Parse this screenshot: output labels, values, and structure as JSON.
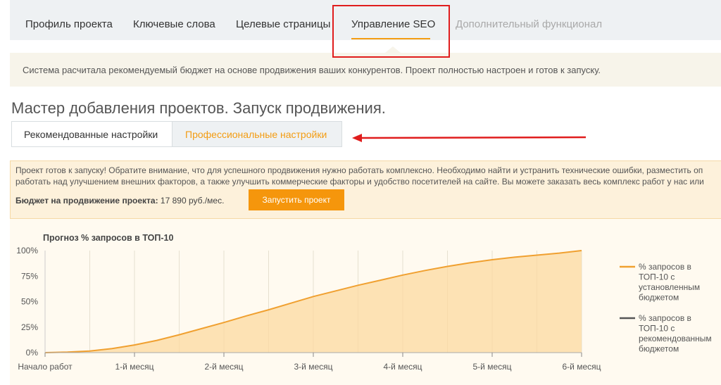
{
  "nav": {
    "tabs": [
      {
        "label": "Профиль проекта"
      },
      {
        "label": "Ключевые слова"
      },
      {
        "label": "Целевые страницы"
      },
      {
        "label": "Управление SEO"
      },
      {
        "label": "Дополнительный функционал"
      }
    ],
    "active_index": 3
  },
  "info_bar": {
    "text": "Система расчитала рекомендуемый бюджет на основе продвижения ваших конкурентов. Проект полностью настроен и готов к запуску."
  },
  "page_title": "Мастер добавления проектов. Запуск продвижения.",
  "settings_tabs": {
    "recommended": "Рекомендованные настройки",
    "professional": "Профессиональные настройки"
  },
  "panel": {
    "line1": "Проект готов к запуску! Обратите внимание, что для успешного продвижения нужно работать комплексно. Необходимо найти и устранить технические ошибки, разместить оп",
    "line2": "работать над улучшением внешних факторов, а также улучшить коммерческие факторы и удобство посетителей на сайте. Вы можете заказать весь комплекс работ у нас или",
    "budget_label": "Бюджет на продвижение проекта:",
    "budget_value": "17 890 руб./мес.",
    "launch_button": "Запустить проект"
  },
  "colors": {
    "accent": "#f5960c",
    "series_set": "#f0a030",
    "series_rec": "#555555",
    "area_fill": "#fcd9a0"
  },
  "chart_data": {
    "type": "area",
    "title": "Прогноз % запросов в ТОП-10",
    "categories": [
      "Начало работ",
      "1-й месяц",
      "2-й месяц",
      "3-й месяц",
      "4-й месяц",
      "5-й месяц",
      "6-й месяц"
    ],
    "x": [
      0,
      0.25,
      0.5,
      0.75,
      1,
      1.25,
      1.5,
      1.75,
      2,
      2.25,
      2.5,
      2.75,
      3,
      3.25,
      3.5,
      3.75,
      4,
      4.25,
      4.5,
      4.75,
      5,
      5.25,
      5.5,
      5.75,
      6
    ],
    "ylim": [
      0,
      100
    ],
    "yticks": [
      "0%",
      "25%",
      "50%",
      "75%",
      "100%"
    ],
    "grid": "vertical",
    "legend_position": "right",
    "series": [
      {
        "name": "% запросов в ТОП-10 с установленным бюджетом",
        "name_lines": [
          "% запросов в",
          "ТОП-10 с",
          "установленным",
          "бюджетом"
        ],
        "values": [
          0,
          0.5,
          1.5,
          4,
          7.5,
          12,
          17.5,
          23.5,
          29.5,
          36,
          42,
          48.5,
          55,
          60.5,
          66,
          71,
          76,
          80.5,
          84.5,
          88,
          91,
          93.5,
          95.5,
          97.5,
          100
        ]
      },
      {
        "name": "% запросов в ТОП-10 с рекомендованным бюджетом",
        "name_lines": [
          "% запросов в",
          "ТОП-10 с",
          "рекомендованным",
          "бюджетом"
        ],
        "values": []
      }
    ]
  }
}
